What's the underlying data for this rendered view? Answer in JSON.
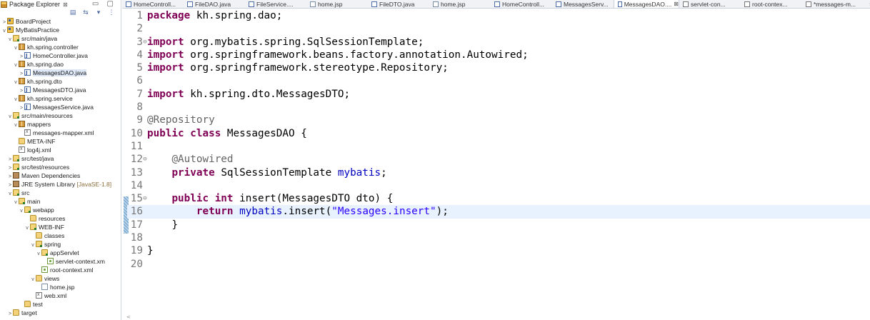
{
  "explorer": {
    "title": "Package Explorer",
    "close": "⊠",
    "win_btns": "▭ ▢",
    "toolbar": [
      "▤",
      "⇆",
      "▾",
      "⋮"
    ],
    "items": [
      {
        "depth": 0,
        "twisty": ">",
        "icon": "project",
        "label": "BoardProject"
      },
      {
        "depth": 0,
        "twisty": "v",
        "icon": "project",
        "label": "MyBatisPractice"
      },
      {
        "depth": 1,
        "twisty": "v",
        "icon": "srcfolder",
        "label": "src/main/java"
      },
      {
        "depth": 2,
        "twisty": "v",
        "icon": "package",
        "label": "kh.spring.controller"
      },
      {
        "depth": 3,
        "twisty": ">",
        "icon": "java",
        "label": "HomeController.java"
      },
      {
        "depth": 2,
        "twisty": "v",
        "icon": "package",
        "label": "kh.spring.dao"
      },
      {
        "depth": 3,
        "twisty": ">",
        "icon": "java",
        "label": "MessagesDAO.java",
        "selected": true
      },
      {
        "depth": 2,
        "twisty": "v",
        "icon": "package",
        "label": "kh.spring.dto"
      },
      {
        "depth": 3,
        "twisty": ">",
        "icon": "java",
        "label": "MessagesDTO.java"
      },
      {
        "depth": 2,
        "twisty": "v",
        "icon": "package",
        "label": "kh.spring.service"
      },
      {
        "depth": 3,
        "twisty": ">",
        "icon": "java",
        "label": "MessagesService.java"
      },
      {
        "depth": 1,
        "twisty": "v",
        "icon": "srcfolder",
        "label": "src/main/resources"
      },
      {
        "depth": 2,
        "twisty": "v",
        "icon": "package",
        "label": "mappers"
      },
      {
        "depth": 3,
        "twisty": "",
        "icon": "xml",
        "label": "messages-mapper.xml"
      },
      {
        "depth": 2,
        "twisty": "",
        "icon": "folder",
        "label": "META-INF"
      },
      {
        "depth": 2,
        "twisty": "",
        "icon": "xml",
        "label": "log4j.xml"
      },
      {
        "depth": 1,
        "twisty": ">",
        "icon": "srcfolder",
        "label": "src/test/java"
      },
      {
        "depth": 1,
        "twisty": ">",
        "icon": "srcfolder",
        "label": "src/test/resources"
      },
      {
        "depth": 1,
        "twisty": ">",
        "icon": "library",
        "label": "Maven Dependencies"
      },
      {
        "depth": 1,
        "twisty": ">",
        "icon": "library",
        "label": "JRE System Library",
        "decor": "[JavaSE-1.8]"
      },
      {
        "depth": 1,
        "twisty": "v",
        "icon": "srcfolder",
        "label": "src"
      },
      {
        "depth": 2,
        "twisty": "v",
        "icon": "srcfolder",
        "label": "main"
      },
      {
        "depth": 3,
        "twisty": "v",
        "icon": "srcfolder",
        "label": "webapp"
      },
      {
        "depth": 4,
        "twisty": "",
        "icon": "folder",
        "label": "resources"
      },
      {
        "depth": 4,
        "twisty": "v",
        "icon": "srcfolder",
        "label": "WEB-INF"
      },
      {
        "depth": 5,
        "twisty": "",
        "icon": "folder",
        "label": "classes"
      },
      {
        "depth": 5,
        "twisty": "v",
        "icon": "srcfolder",
        "label": "spring"
      },
      {
        "depth": 6,
        "twisty": "v",
        "icon": "srcfolder",
        "label": "appServlet"
      },
      {
        "depth": 7,
        "twisty": "",
        "icon": "spring-xml",
        "label": "servlet-context.xm"
      },
      {
        "depth": 6,
        "twisty": "",
        "icon": "spring-xml",
        "label": "root-context.xml"
      },
      {
        "depth": 5,
        "twisty": "v",
        "icon": "folder",
        "label": "views"
      },
      {
        "depth": 6,
        "twisty": "",
        "icon": "jsp",
        "label": "home.jsp"
      },
      {
        "depth": 5,
        "twisty": "",
        "icon": "xml",
        "label": "web.xml"
      },
      {
        "depth": 3,
        "twisty": "",
        "icon": "folder",
        "label": "test"
      },
      {
        "depth": 1,
        "twisty": ">",
        "icon": "folder",
        "label": "target"
      }
    ]
  },
  "tabs": [
    {
      "label": "HomeControll...",
      "icon": "java"
    },
    {
      "label": "FileDAO.java",
      "icon": "java"
    },
    {
      "label": "FileService....",
      "icon": "java"
    },
    {
      "label": "home.jsp",
      "icon": "jsp"
    },
    {
      "label": "FileDTO.java",
      "icon": "java"
    },
    {
      "label": "home.jsp",
      "icon": "jsp"
    },
    {
      "label": "HomeControll...",
      "icon": "java"
    },
    {
      "label": "MessagesServ...",
      "icon": "java"
    },
    {
      "label": "MessagesDAO....",
      "icon": "java",
      "active": true,
      "close": "⊠"
    },
    {
      "label": "servlet-con...",
      "icon": "xml"
    },
    {
      "label": "root-contex...",
      "icon": "xml"
    },
    {
      "label": "*messages-m...",
      "icon": "xml"
    }
  ],
  "tabs_overflow": "»14",
  "code": [
    {
      "n": "1",
      "segs": [
        [
          "kw",
          "package"
        ],
        [
          "",
          "kh.spring.dao;"
        ]
      ]
    },
    {
      "n": "2",
      "segs": []
    },
    {
      "n": "3",
      "fold": "⊖",
      "segs": [
        [
          "kw",
          "import"
        ],
        [
          "",
          "org.mybatis.spring.SqlSessionTemplate;"
        ]
      ]
    },
    {
      "n": "4",
      "segs": [
        [
          "kw",
          "import"
        ],
        [
          "",
          "org.springframework.beans.factory.annotation.Autowired;"
        ]
      ]
    },
    {
      "n": "5",
      "segs": [
        [
          "kw",
          "import"
        ],
        [
          "",
          "org.springframework.stereotype.Repository;"
        ]
      ]
    },
    {
      "n": "6",
      "segs": []
    },
    {
      "n": "7",
      "segs": [
        [
          "kw",
          "import"
        ],
        [
          "",
          "kh.spring.dto.MessagesDTO;"
        ]
      ]
    },
    {
      "n": "8",
      "segs": []
    },
    {
      "n": "9",
      "segs": [
        [
          "ann",
          "@Repository"
        ]
      ]
    },
    {
      "n": "10",
      "segs": [
        [
          "kw",
          "public"
        ],
        [
          "kw",
          "class"
        ],
        [
          "",
          "MessagesDAO {"
        ]
      ]
    },
    {
      "n": "11",
      "segs": []
    },
    {
      "n": "12",
      "fold": "⊖",
      "indent": 1,
      "segs": [
        [
          "ann",
          "@Autowired"
        ]
      ]
    },
    {
      "n": "13",
      "indent": 1,
      "segs": [
        [
          "kw",
          "private"
        ],
        [
          "",
          "SqlSessionTemplate"
        ],
        [
          "fld",
          "mybatis"
        ],
        [
          "nosp",
          ";"
        ]
      ]
    },
    {
      "n": "14",
      "segs": []
    },
    {
      "n": "15",
      "fold": "⊖",
      "indent": 1,
      "segs": [
        [
          "kw",
          "public"
        ],
        [
          "kw",
          "int"
        ],
        [
          "",
          "insert(MessagesDTO dto) {"
        ]
      ]
    },
    {
      "n": "16",
      "indent": 2,
      "current": true,
      "segs": [
        [
          "kw",
          "return"
        ],
        [
          "fld",
          "mybatis"
        ],
        [
          "nosp",
          ".insert("
        ],
        [
          "strn",
          "\"Messages.insert\""
        ],
        [
          "nosp",
          ");"
        ]
      ]
    },
    {
      "n": "17",
      "indent": 1,
      "segs": [
        [
          "",
          "}"
        ]
      ]
    },
    {
      "n": "18",
      "segs": []
    },
    {
      "n": "19",
      "segs": [
        [
          "",
          "}"
        ]
      ]
    },
    {
      "n": "20",
      "segs": []
    }
  ],
  "scroll_left": "<"
}
